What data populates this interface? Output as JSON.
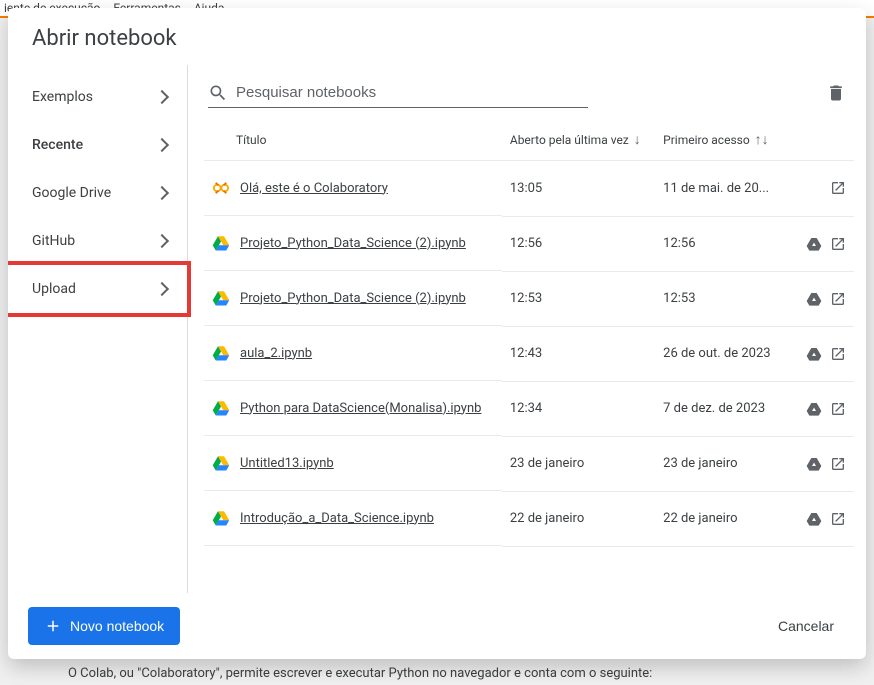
{
  "bg_menu": {
    "item1": "iente de execução",
    "item2": "Ferramentas",
    "item3": "Ajuda"
  },
  "bg_footer": "O Colab, ou \"Colaboratory\", permite escrever e executar Python no navegador e conta com o seguinte:",
  "dialog": {
    "title": "Abrir notebook",
    "search_placeholder": "Pesquisar notebooks",
    "new_notebook_label": "Novo notebook",
    "cancel_label": "Cancelar"
  },
  "sidebar": {
    "items": [
      {
        "label": "Exemplos"
      },
      {
        "label": "Recente"
      },
      {
        "label": "Google Drive"
      },
      {
        "label": "GitHub"
      },
      {
        "label": "Upload"
      }
    ]
  },
  "columns": {
    "title": "Título",
    "last_opened": "Aberto pela última vez",
    "first_access": "Primeiro acesso"
  },
  "rows": [
    {
      "icon": "colab",
      "title": "Olá, este é o Colaboratory",
      "last_opened": "13:05",
      "first_access": "11 de mai. de 20...",
      "has_drive": false
    },
    {
      "icon": "drive",
      "title": "Projeto_Python_Data_Science (2).ipynb",
      "last_opened": "12:56",
      "first_access": "12:56",
      "has_drive": true
    },
    {
      "icon": "drive",
      "title": "Projeto_Python_Data_Science (2).ipynb",
      "last_opened": "12:53",
      "first_access": "12:53",
      "has_drive": true
    },
    {
      "icon": "drive",
      "title": "aula_2.ipynb",
      "last_opened": "12:43",
      "first_access": "26 de out. de 2023",
      "has_drive": true
    },
    {
      "icon": "drive",
      "title": "Python para DataScience(Monalisa).ipynb",
      "last_opened": "12:34",
      "first_access": "7 de dez. de 2023",
      "has_drive": true
    },
    {
      "icon": "drive",
      "title": "Untitled13.ipynb",
      "last_opened": "23 de janeiro",
      "first_access": "23 de janeiro",
      "has_drive": true
    },
    {
      "icon": "drive",
      "title": "Introdução_a_Data_Science.ipynb",
      "last_opened": "22 de janeiro",
      "first_access": "22 de janeiro",
      "has_drive": true
    }
  ]
}
